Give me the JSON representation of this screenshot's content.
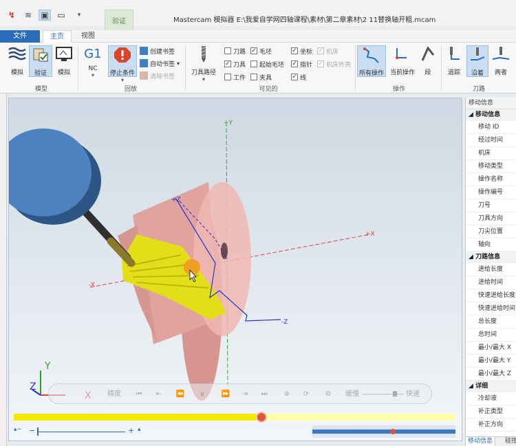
{
  "titlebar": {
    "title": "Mastercam 模拟器  E:\\我爱自学网四轴课程\\素材\\第二章素材\\2 11替换轴开粗.mcam"
  },
  "context_tab": {
    "top": "验证",
    "bottom": "验证"
  },
  "tabs": {
    "file": "文件",
    "home": "主页",
    "view": "视图"
  },
  "ribbon": {
    "model": {
      "simulate": "模拟",
      "verify": "验证",
      "simulate2": "模拟",
      "group": "模型"
    },
    "playback": {
      "nc": "NC",
      "stop_condition": "停止条件",
      "create_bookmark": "创建书签",
      "auto_bookmark": "自动书签",
      "clear_bookmark": "清除书签",
      "group": "回放"
    },
    "visibility": {
      "toolpath_group": "刀具路径",
      "tool_path": "刀路",
      "tool": "刀具",
      "workpiece": "工件",
      "stock": "毛坯",
      "initial_stock": "起始毛坯",
      "fixture": "夹具",
      "axis": "坐标",
      "pointer": "指针",
      "line": "线",
      "machine": "机床",
      "machine_housing": "机床外壳",
      "group": "可见的"
    },
    "operation": {
      "all_ops": "所有操作",
      "current_op": "当前操作",
      "segment": "段",
      "group": "操作"
    },
    "toolpath": {
      "back": "追踪",
      "along": "沿着",
      "both": "两者",
      "group": "刀路"
    }
  },
  "right_panel": {
    "title": "移动信息",
    "section1": "移动信息",
    "rows1": [
      "移动 ID",
      "经过时间",
      "机床",
      "移动类型",
      "操作名称",
      "操作编号",
      "刀号",
      "刀具方向",
      "刀尖位置",
      "轴向"
    ],
    "section2": "刀路信息",
    "rows2": [
      "进给长度",
      "进给时间",
      "快速进给长度",
      "快速进给时间",
      "总长度",
      "总时间",
      "最小/最大 X",
      "最小/最大 Y",
      "最小/最大 Z"
    ],
    "section3": "详细",
    "rows3": [
      "冷却液",
      "补正类型",
      "补正方向"
    ],
    "tab_selected": "移动信息",
    "tab_other": "碰撞"
  },
  "viewport": {
    "axis_labels": {
      "y_pos": "+Y",
      "x_pos": "+X",
      "x_neg": "-X",
      "z_pos": "+Z",
      "z_neg": "-Z"
    },
    "triad": {
      "x": "X",
      "y": "Y",
      "z": "Z"
    }
  },
  "playback_bar": {
    "precision": "精度",
    "slow": "缓慢",
    "fast": "快速"
  },
  "progress": {
    "value": 0.56
  },
  "colors": {
    "accent": "#2b6cb8",
    "progress": "#f5ea00",
    "stock": "#e8a8a4",
    "cut": "#e6e400",
    "holder": "#3d6fa6"
  }
}
